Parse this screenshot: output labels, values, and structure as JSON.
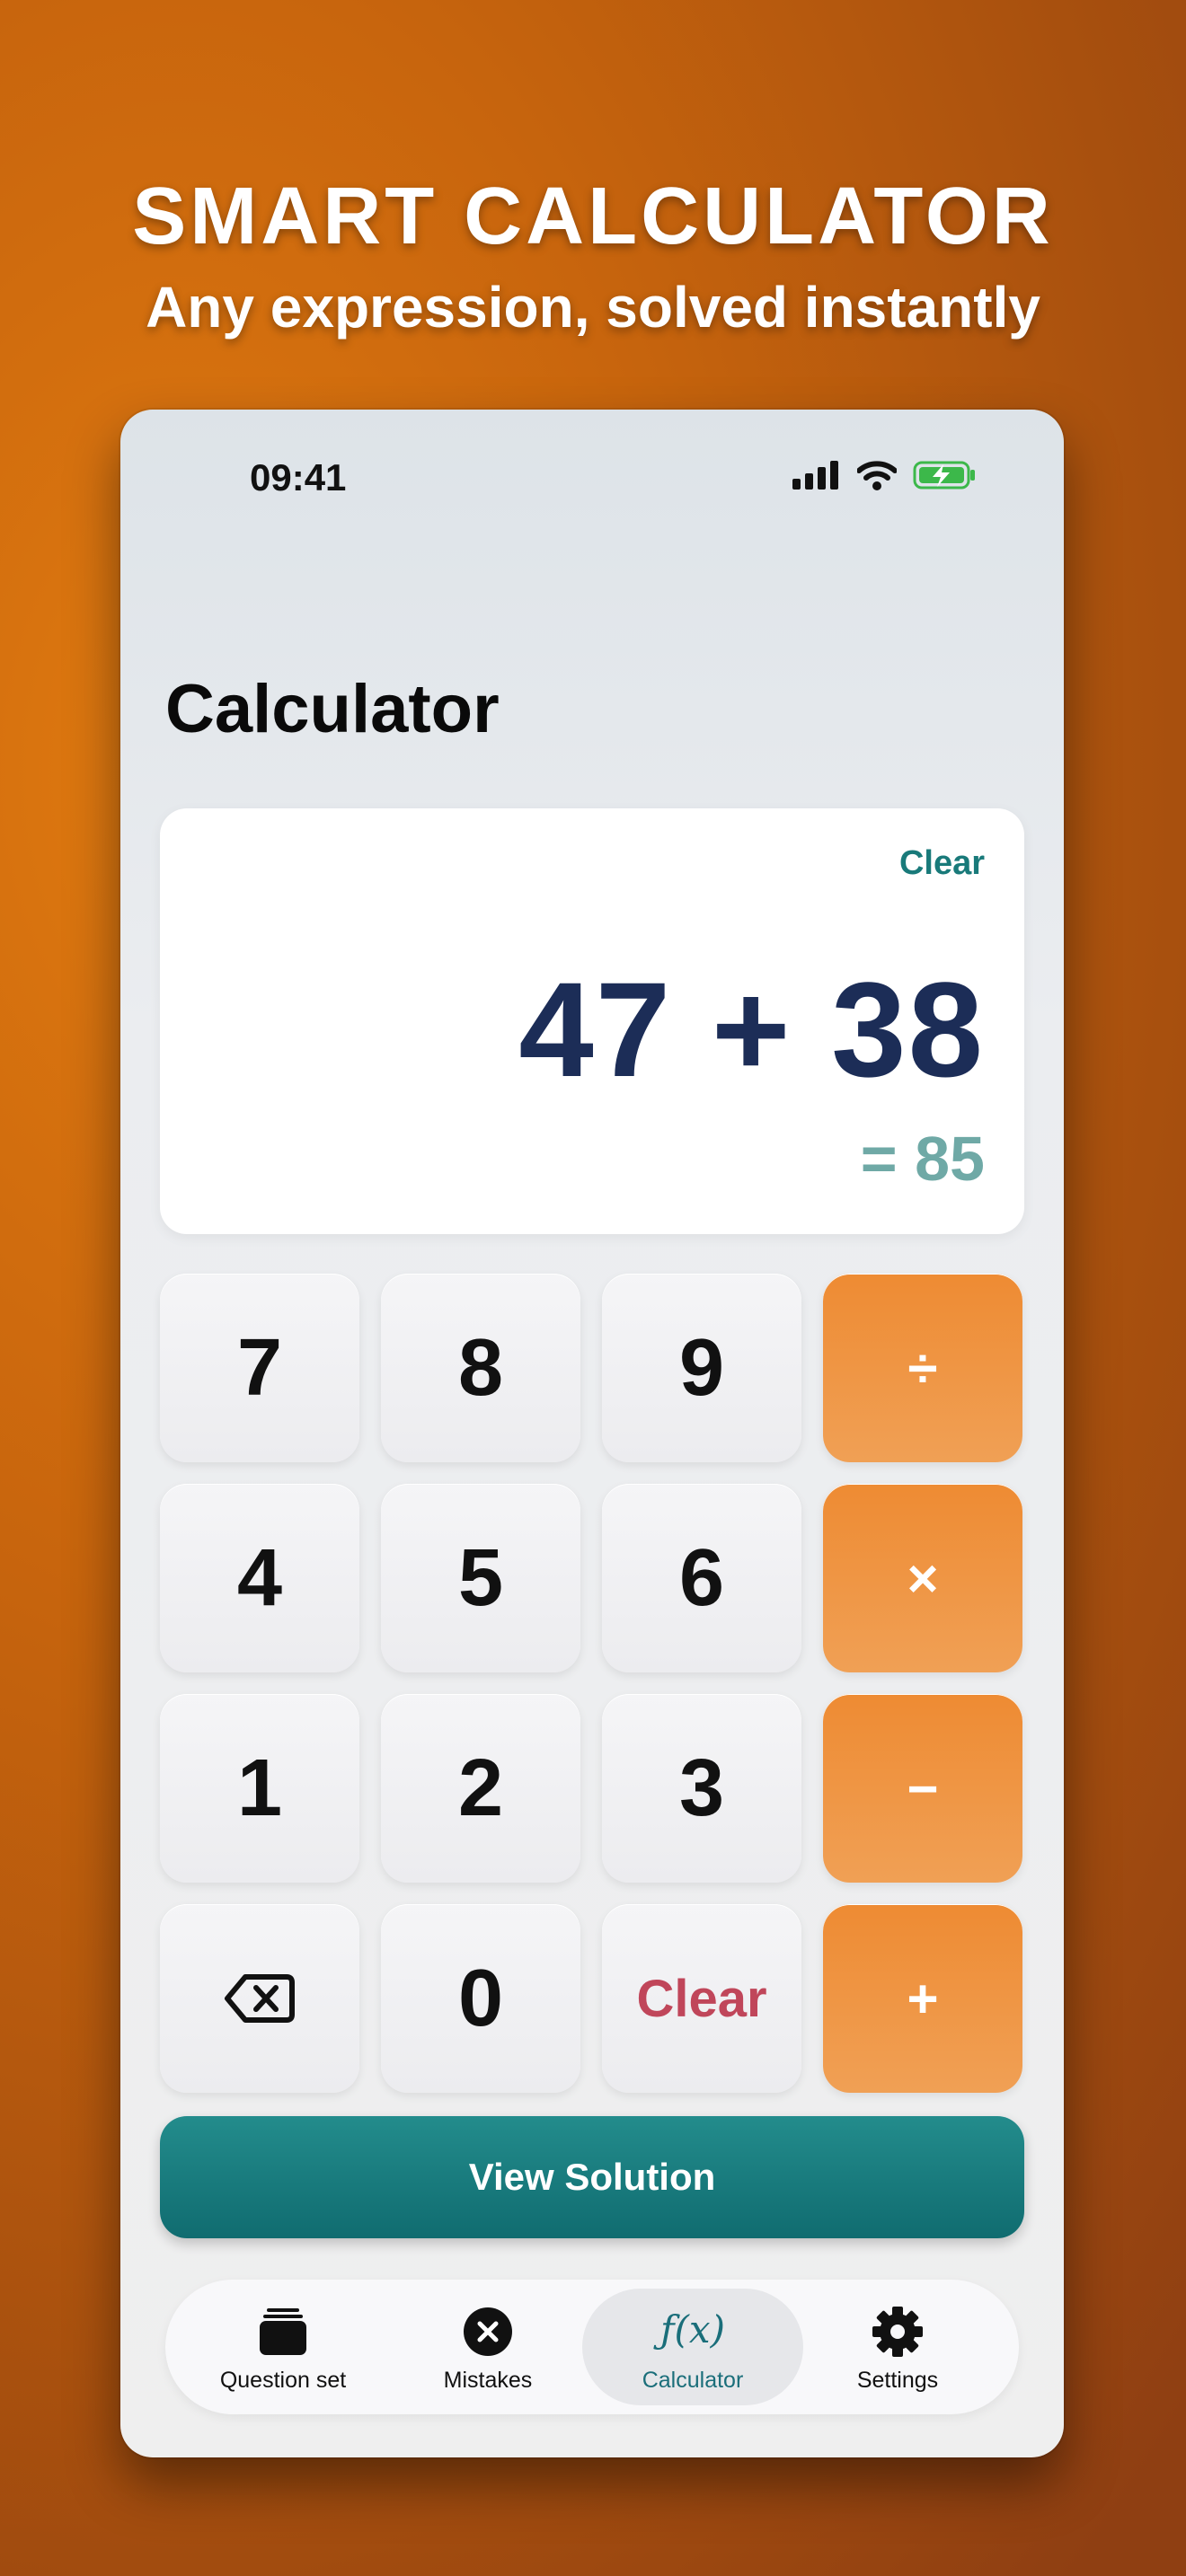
{
  "marketing": {
    "title": "SMART CALCULATOR",
    "subtitle": "Any expression, solved instantly"
  },
  "status_bar": {
    "time": "09:41",
    "icons": [
      "cellular-signal-icon",
      "wifi-icon",
      "battery-charging-icon"
    ]
  },
  "page": {
    "title": "Calculator"
  },
  "display": {
    "clear_label": "Clear",
    "expression": "47 + 38",
    "result": "= 85"
  },
  "keypad": {
    "rows": [
      [
        {
          "label": "7"
        },
        {
          "label": "8"
        },
        {
          "label": "9"
        },
        {
          "label": "÷"
        }
      ],
      [
        {
          "label": "4"
        },
        {
          "label": "5"
        },
        {
          "label": "6"
        },
        {
          "label": "×"
        }
      ],
      [
        {
          "label": "1"
        },
        {
          "label": "2"
        },
        {
          "label": "3"
        },
        {
          "label": "−"
        }
      ],
      [
        {
          "icon": "backspace-icon"
        },
        {
          "label": "0"
        },
        {
          "label": "Clear"
        },
        {
          "label": "+"
        }
      ]
    ]
  },
  "view_solution_label": "View Solution",
  "tabbar": {
    "tabs": [
      {
        "label": "Question set",
        "icon": "stack-icon",
        "active": false
      },
      {
        "label": "Mistakes",
        "icon": "x-circle-icon",
        "active": false
      },
      {
        "label": "Calculator",
        "icon": "function-icon",
        "glyph": "ƒ(x)",
        "active": true
      },
      {
        "label": "Settings",
        "icon": "gear-icon",
        "active": false
      }
    ]
  },
  "colors": {
    "accent_teal": "#1a6e7a",
    "operator_orange": "#ee8b33",
    "expression_navy": "#1c2d57",
    "clear_red": "#c0465a"
  }
}
